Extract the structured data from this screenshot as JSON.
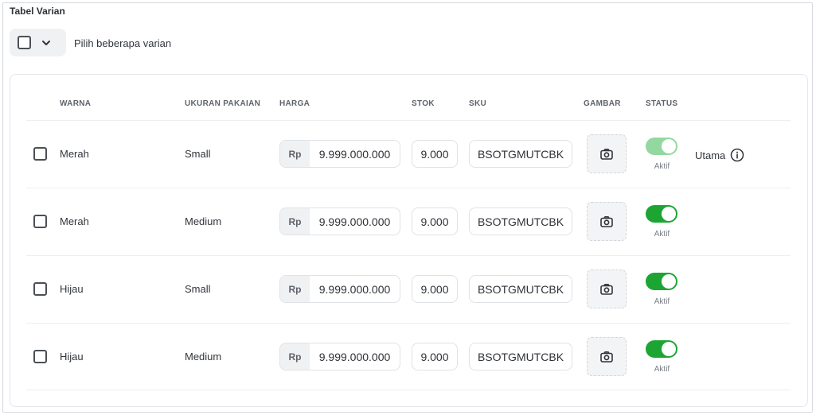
{
  "section_title": "Tabel Varian",
  "bulk_select": {
    "label": "Pilih beberapa varian",
    "checked": false
  },
  "table": {
    "headers": {
      "warna": "WARNA",
      "ukuran": "UKURAN PAKAIAN",
      "harga": "HARGA",
      "stok": "STOK",
      "sku": "SKU",
      "gambar": "GAMBAR",
      "status": "STATUS"
    },
    "currency_prefix": "Rp",
    "rows": [
      {
        "warna": "Merah",
        "ukuran": "Small",
        "harga": "9.999.000.000",
        "stok": "9.000",
        "sku": "BSOTGMUTCBK",
        "status": "Aktif",
        "main_label": "Utama"
      },
      {
        "warna": "Merah",
        "ukuran": "Medium",
        "harga": "9.999.000.000",
        "stok": "9.000",
        "sku": "BSOTGMUTCBK",
        "status": "Aktif"
      },
      {
        "warna": "Hijau",
        "ukuran": "Small",
        "harga": "9.999.000.000",
        "stok": "9.000",
        "sku": "BSOTGMUTCBK",
        "status": "Aktif"
      },
      {
        "warna": "Hijau",
        "ukuran": "Medium",
        "harga": "9.999.000.000",
        "stok": "9.000",
        "sku": "BSOTGMUTCBK",
        "status": "Aktif"
      }
    ]
  },
  "colors": {
    "toggle_on": "#1da533",
    "toggle_on_disabled": "#93d8a0",
    "text": "#31353b",
    "muted": "#5e636b"
  },
  "icons": {
    "bulk_dropdown": "chevron-down-icon",
    "image_upload": "camera-icon",
    "info": "info-icon"
  }
}
